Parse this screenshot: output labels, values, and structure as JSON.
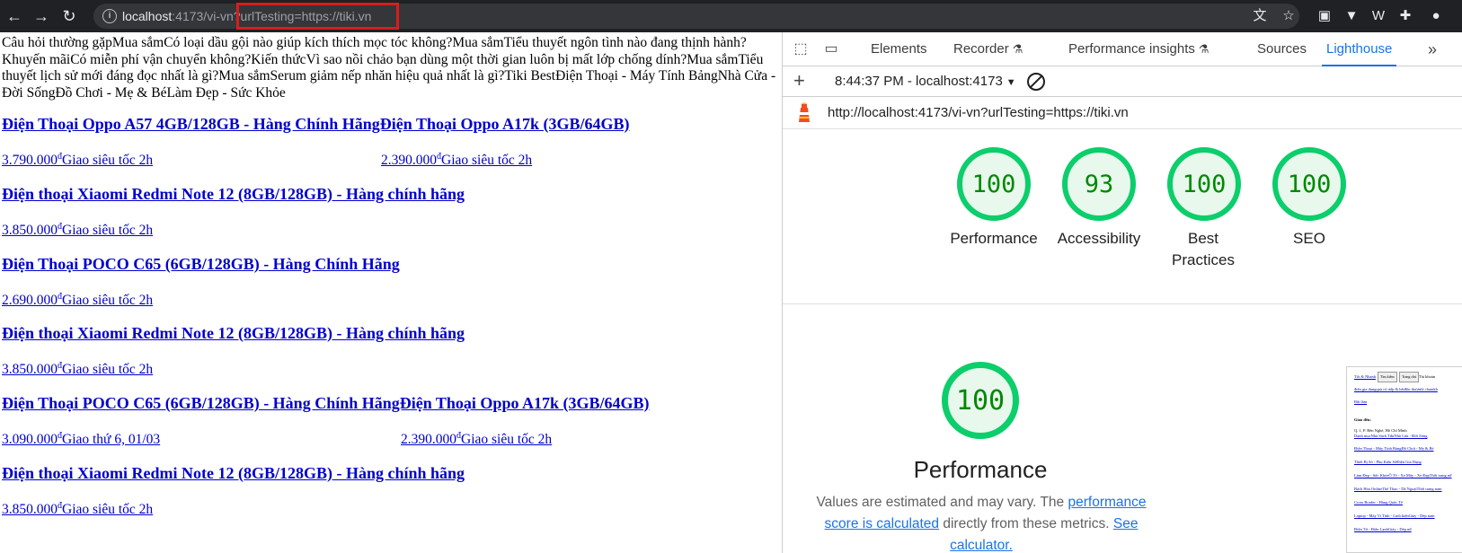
{
  "browser": {
    "url_host": "localhost",
    "url_rest": ":4173/vi-vn",
    "url_query": "?urlTesting=https://tiki.vn"
  },
  "page": {
    "intro": "Câu hỏi thường gặpMua sắmCó loại dầu gội nào giúp kích thích mọc tóc không?Mua sắmTiểu thuyết ngôn tình nào đang thịnh hành?Khuyến mãiCó miễn phí vận chuyển không?Kiến thứcVì sao nồi chảo bạn dùng một thời gian luôn bị mất lớp chống dính?Mua sắmTiểu thuyết lịch sử mới đáng đọc nhất là gì?Mua sắmSerum giảm nếp nhăn hiệu quả nhất là gì?Tiki BestĐiện Thoại - Máy Tính BảngNhà Cửa - Đời SốngĐồ Chơi - Mẹ & BéLàm Đẹp - Sức Khỏe",
    "products": [
      {
        "title": "Điện Thoại Oppo A57 4GB/128GB - Hàng Chính HãngĐiện Thoại Oppo A17k (3GB/64GB)",
        "prices": [
          {
            "amount": "3.790.000",
            "currency": "đ",
            "delivery": "Giao siêu tốc 2h"
          },
          {
            "amount": "2.390.000",
            "currency": "đ",
            "delivery": "Giao siêu tốc 2h"
          }
        ]
      },
      {
        "title": "Điện thoại Xiaomi Redmi Note 12 (8GB/128GB) - Hàng chính hãng",
        "prices": [
          {
            "amount": "3.850.000",
            "currency": "đ",
            "delivery": "Giao siêu tốc 2h"
          }
        ]
      },
      {
        "title": "Điện Thoại POCO C65 (6GB/128GB) - Hàng Chính Hãng",
        "prices": [
          {
            "amount": "2.690.000",
            "currency": "đ",
            "delivery": "Giao siêu tốc 2h"
          }
        ]
      },
      {
        "title": "Điện thoại Xiaomi Redmi Note 12 (8GB/128GB) - Hàng chính hãng",
        "prices": [
          {
            "amount": "3.850.000",
            "currency": "đ",
            "delivery": "Giao siêu tốc 2h"
          }
        ]
      },
      {
        "title": "Điện Thoại POCO C65 (6GB/128GB) - Hàng Chính HãngĐiện Thoại Oppo A17k (3GB/64GB)",
        "prices": [
          {
            "amount": "3.090.000",
            "currency": "đ",
            "delivery": "Giao thứ 6, 01/03"
          },
          {
            "amount": "2.390.000",
            "currency": "đ",
            "delivery": "Giao siêu tốc 2h"
          }
        ]
      },
      {
        "title": "Điện thoại Xiaomi Redmi Note 12 (8GB/128GB) - Hàng chính hãng",
        "prices": [
          {
            "amount": "3.850.000",
            "currency": "đ",
            "delivery": "Giao siêu tốc 2h"
          }
        ]
      }
    ]
  },
  "devtools": {
    "tabs": [
      "Elements",
      "Recorder",
      "Performance insights",
      "Sources",
      "Lighthouse"
    ],
    "active_tab": "Lighthouse",
    "more": "»",
    "report_label": "8:44:37 PM - localhost:4173",
    "report_url": "http://localhost:4173/vi-vn?urlTesting=https://tiki.vn",
    "scores": [
      {
        "value": "100",
        "label": "Performance"
      },
      {
        "value": "93",
        "label": "Accessibility"
      },
      {
        "value": "100",
        "label": "Best Practices"
      },
      {
        "value": "100",
        "label": "SEO"
      }
    ],
    "perf_score": "100",
    "perf_title": "Performance",
    "perf_desc_1": "Values are estimated and may vary. The ",
    "perf_link_1": "performance score is calculated",
    "perf_desc_2": " directly from these metrics. ",
    "perf_link_2": "See calculator.",
    "colors": {
      "pass": "#0cce6b",
      "accent": "#1a73e8"
    }
  },
  "thumbnail": {
    "top_link": "Tốt & Nhanh",
    "buttons": [
      "Tìm kiếm",
      "Trang chủ"
    ],
    "account": "Tài khoản",
    "lines": [
      "điện gia dụngquà cổ   ướp & bấtđồn thượnlà claunkh",
      "Bất lâm",
      "Giao đến:",
      "Q. 1, P. Bến Nghé, Hồ Chí Minh",
      "Danh mụcNhà Sách TikiNhà Cửa - Đời Sống",
      "Điện Thoại - Máy Tính BảngĐồ Chơi - Mẹ & Bé",
      "Thiết Bị Số - Phụ Kiện SốĐiện Gia Dụng",
      "Làm Đẹp - Sức KhỏeÔ Tô - Xe Máy - Xe ĐạpThời trang nữ",
      "Bách Hóa OnlineThể Thao - Dã NgoạiThời trang nam",
      "Cross Border - Hàng Quốc Tế",
      "Laptop - Máy Vi Tính - Linh kiệnGiày - Dép nam",
      "Điện Tử - Điện LạnhGiày - Dép nữ"
    ]
  }
}
